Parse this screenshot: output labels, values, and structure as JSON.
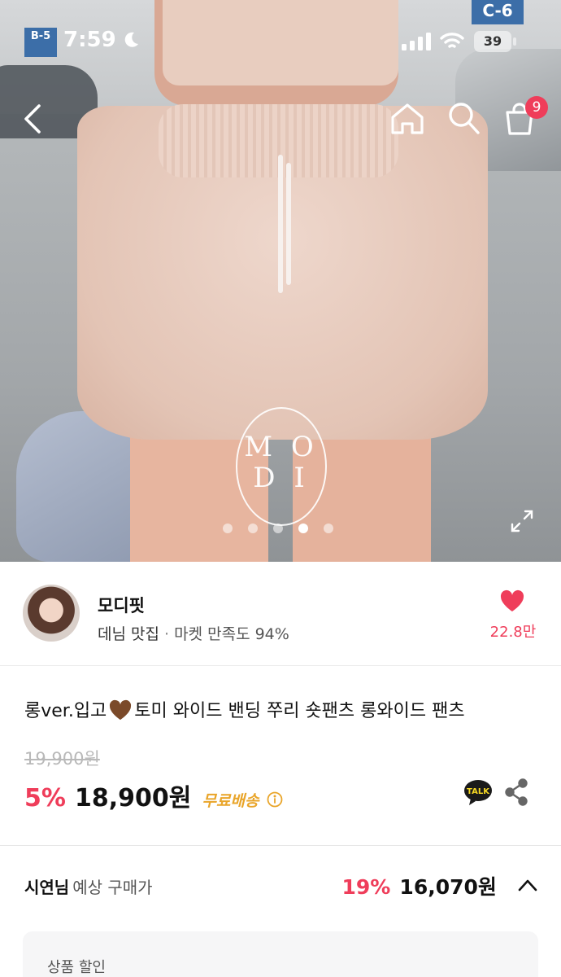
{
  "status_bar": {
    "time": "7:59",
    "battery": "39"
  },
  "nav": {
    "cart_count": "9"
  },
  "hero": {
    "logo_text": "MODI",
    "pagination": {
      "count": 5,
      "active_index": 3
    }
  },
  "seller": {
    "name": "모디핏",
    "tag": "데님 맛집",
    "separator": "·",
    "satisfaction": "마켓 만족도 94%",
    "likes": "22.8만"
  },
  "product": {
    "title_prefix": "롱ver.입고",
    "title_suffix": "토미 와이드 밴딩 쭈리 숏팬츠 롱와이드 팬츠",
    "original_price": "19,900원",
    "discount": "5%",
    "price": "18,900원",
    "shipping": "무료배송"
  },
  "member": {
    "name": "시연님",
    "label": "예상 구매가",
    "discount": "19%",
    "price": "16,070원"
  },
  "discount_box": {
    "label": "상품 할인"
  },
  "colors": {
    "accent": "#ef3d5a",
    "shipping": "#e9a52a"
  },
  "icons": [
    "back-icon",
    "home-icon",
    "search-icon",
    "cart-icon",
    "expand-icon",
    "heart-icon",
    "info-icon",
    "kakaotalk-icon",
    "share-icon",
    "chevron-up-icon"
  ]
}
